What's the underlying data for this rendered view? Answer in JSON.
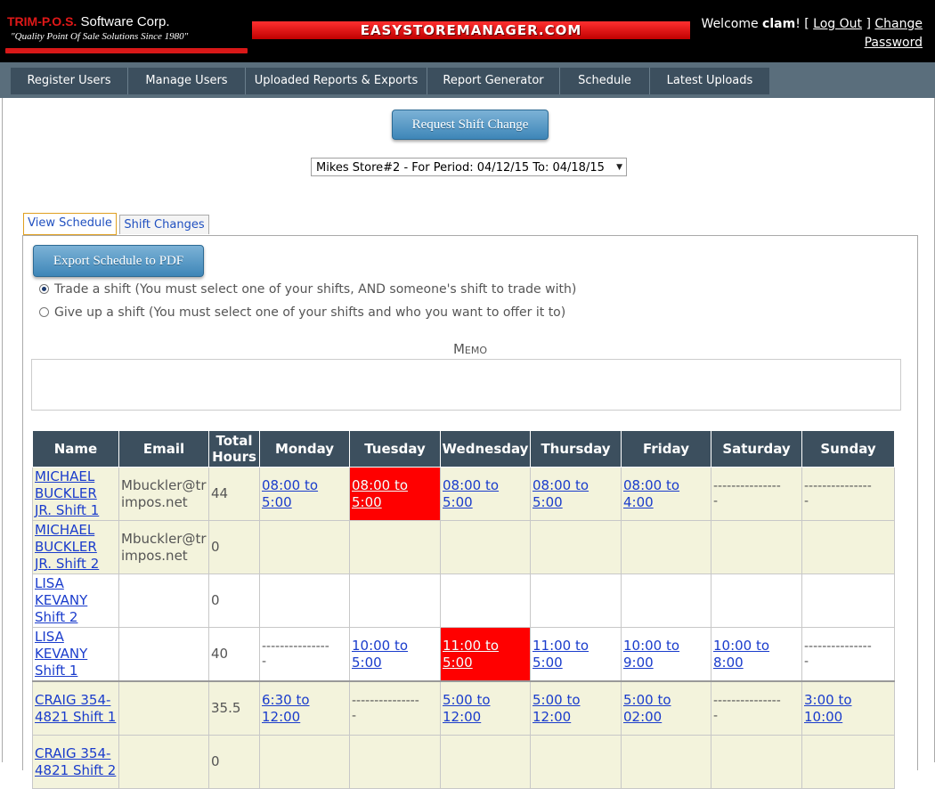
{
  "header": {
    "brand_name": "TRIM-P.O.S.",
    "brand_suffix": " Software Corp.",
    "tagline": "\"Quality Point Of Sale Solutions Since 1980\"",
    "banner": "EASYSTOREMANAGER.COM",
    "welcome_prefix": "Welcome ",
    "user": "clam",
    "log_out": "Log Out",
    "change_password": "Change Password"
  },
  "nav": [
    {
      "label": "Register Users"
    },
    {
      "label": "Manage Users"
    },
    {
      "label": "Uploaded Reports & Exports"
    },
    {
      "label": "Report Generator"
    },
    {
      "label": "Schedule"
    },
    {
      "label": "Latest Uploads"
    }
  ],
  "actions": {
    "request_shift_change": "Request Shift Change",
    "export_pdf": "Export Schedule to PDF"
  },
  "period": {
    "selected": "Mikes Store#2 - For Period: 04/12/15 To: 04/18/15"
  },
  "tabs": {
    "view_schedule": "View Schedule",
    "shift_changes": "Shift Changes"
  },
  "options": {
    "trade": "Trade a shift (You must select one of your shifts, AND someone's shift to trade with)",
    "give_up": "Give up a shift (You must select one of your shifts and who you want to offer it to)"
  },
  "memo": {
    "label": "Memo",
    "value": ""
  },
  "table": {
    "headers": [
      "Name",
      "Email",
      "Total Hours",
      "Monday",
      "Tuesday",
      "Wednesday",
      "Thursday",
      "Friday",
      "Saturday",
      "Sunday"
    ],
    "dash": "---------------",
    "dash2": "-",
    "rows": [
      {
        "name": "MICHAEL BUCKLER JR. Shift 1",
        "email": "Mbuckler@trimpos.net",
        "hours": "44",
        "days": [
          "08:00 to 5:00",
          "08:00 to 5:00",
          "08:00 to 5:00",
          "08:00 to 5:00",
          "08:00 to 4:00",
          "",
          ""
        ]
      },
      {
        "name": "MICHAEL BUCKLER JR. Shift 2",
        "email": "Mbuckler@trimpos.net",
        "hours": "0",
        "days": [
          "",
          "",
          "",
          "",
          "",
          "",
          ""
        ]
      },
      {
        "name": "LISA KEVANY Shift 2",
        "email": "",
        "hours": "0",
        "days": [
          "",
          "",
          "",
          "",
          "",
          "",
          ""
        ]
      },
      {
        "name": "LISA KEVANY Shift 1",
        "email": "",
        "hours": "40",
        "days": [
          "",
          "10:00 to 5:00",
          "11:00 to 5:00",
          "11:00 to 5:00",
          "10:00 to 9:00",
          "10:00 to 8:00",
          ""
        ]
      },
      {
        "name": "CRAIG 354-4821 Shift 1",
        "email": "",
        "hours": "35.5",
        "days": [
          "6:30 to 12:00",
          "",
          "5:00 to 12:00",
          "5:00 to 12:00",
          "5:00 to 02:00",
          "",
          "3:00 to 10:00"
        ]
      },
      {
        "name": "CRAIG 354-4821 Shift 2",
        "email": "",
        "hours": "0",
        "days": [
          "",
          "",
          "",
          "",
          "",
          "",
          ""
        ]
      }
    ]
  },
  "colors": {
    "nav_bg": "#3c4f5e",
    "highlight": "#ff0000",
    "row_alt": "#f3f3dc",
    "link": "#1a3ccc"
  }
}
